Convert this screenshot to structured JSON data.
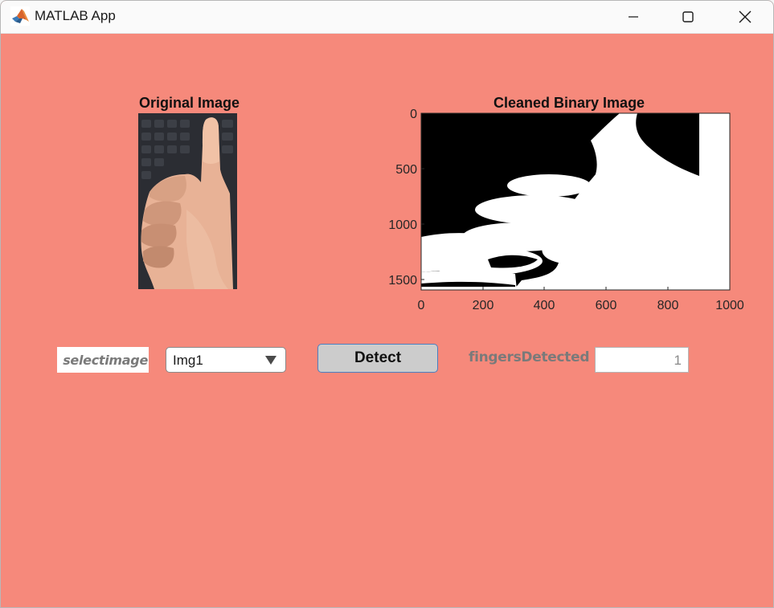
{
  "window": {
    "title": "MATLAB App",
    "background_color": "#f6897b"
  },
  "titlebar_icons": {
    "app": "matlab-logo-icon",
    "minimize": "minimize-icon",
    "maximize": "maximize-icon",
    "close": "close-icon"
  },
  "original_axes": {
    "title": "Original Image"
  },
  "binary_axes": {
    "title": "Cleaned Binary Image",
    "x_ticks": [
      "0",
      "200",
      "400",
      "600",
      "800",
      "1000"
    ],
    "y_ticks": [
      "0",
      "500",
      "1000",
      "1500"
    ]
  },
  "controls": {
    "select_label": "selectimage",
    "select_value": "Img1",
    "select_arrow_icon": "triangle-down-icon",
    "detect_label": "Detect",
    "fingers_label": "fingersDetected",
    "fingers_value": "1"
  }
}
